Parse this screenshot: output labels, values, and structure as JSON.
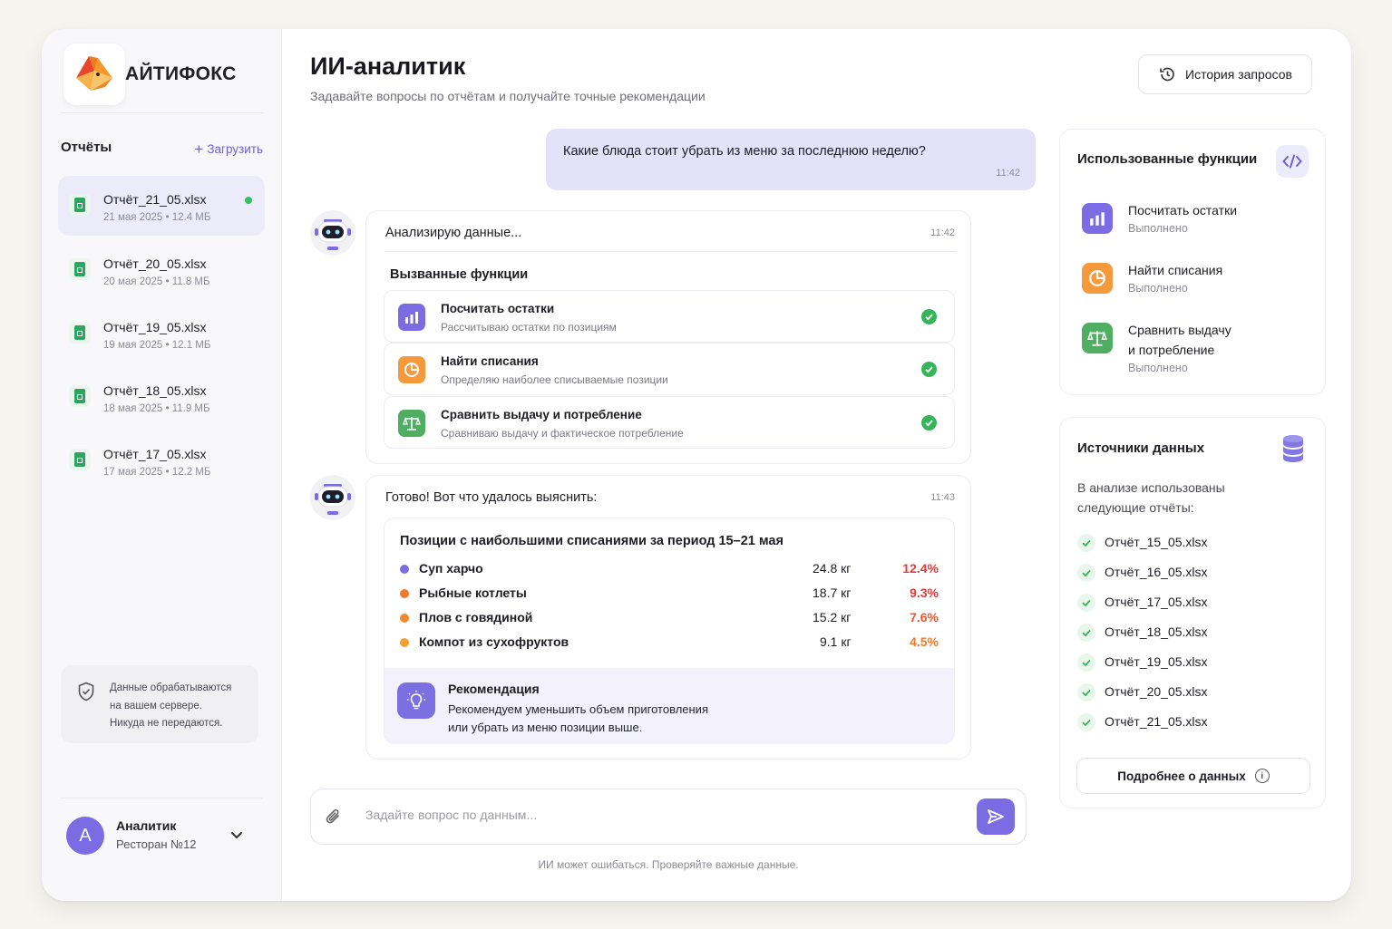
{
  "brand": {
    "name": "АЙТИФОКС"
  },
  "sidebar": {
    "reports_title": "Отчёты",
    "upload_label": "Загрузить",
    "files": [
      {
        "name": "Отчёт_21_05.xlsx",
        "meta": "21 мая 2025 • 12.4 МБ",
        "active": true
      },
      {
        "name": "Отчёт_20_05.xlsx",
        "meta": "20 мая 2025 • 11.8 МБ"
      },
      {
        "name": "Отчёт_19_05.xlsx",
        "meta": "19 мая 2025 • 12.1 МБ"
      },
      {
        "name": "Отчёт_18_05.xlsx",
        "meta": "18 мая 2025 • 11.9 МБ"
      },
      {
        "name": "Отчёт_17_05.xlsx",
        "meta": "17 мая 2025 • 12.2 МБ"
      }
    ],
    "security_lines": [
      "Данные обрабатываются",
      "на вашем сервере.",
      "Никуда не передаются."
    ],
    "user": {
      "initial": "А",
      "name": "Аналитик",
      "sub": "Ресторан №12"
    }
  },
  "header": {
    "title": "ИИ-аналитик",
    "subtitle": "Задавайте вопросы по отчётам и получайте точные рекомендации",
    "history_label": "История запросов"
  },
  "chat": {
    "user_message": {
      "text": "Какие блюда стоит убрать из меню за последнюю неделю?",
      "time": "11:42"
    },
    "analyzing": {
      "text": "Анализирую данные...",
      "time": "11:42",
      "functions_title": "Вызванные функции",
      "functions": [
        {
          "title": "Посчитать остатки",
          "desc": "Рассчитываю остатки по позициям",
          "icon": "bar-chart-icon",
          "color": "#7b6ce3"
        },
        {
          "title": "Найти списания",
          "desc": "Определяю наиболее списываемые позиции",
          "icon": "pie-chart-icon",
          "color": "#f59a3c"
        },
        {
          "title": "Сравнить выдачу и потребление",
          "desc": "Сравниваю выдачу и фактическое потребление",
          "icon": "scales-icon",
          "color": "#4fae62"
        }
      ]
    },
    "result": {
      "text": "Готово! Вот что удалось выяснить:",
      "time": "11:43",
      "table_title": "Позиции с наибольшими списаниями за период 15–21 мая",
      "rows": [
        {
          "name": "Суп харчо",
          "kg": "24.8 кг",
          "pct": "12.4%",
          "dot": "#7b6ce3",
          "pct_color": "#e03a3a"
        },
        {
          "name": "Рыбные котлеты",
          "kg": "18.7 кг",
          "pct": "9.3%",
          "dot": "#f07a2a",
          "pct_color": "#e03a3a"
        },
        {
          "name": "Плов с говядиной",
          "kg": "15.2 кг",
          "pct": "7.6%",
          "dot": "#f08a2a",
          "pct_color": "#e8552e"
        },
        {
          "name": "Компот из сухофруктов",
          "kg": "9.1 кг",
          "pct": "4.5%",
          "dot": "#f5a030",
          "pct_color": "#f07a2a"
        }
      ],
      "recommendation_title": "Рекомендация",
      "recommendation_lines": [
        "Рекомендуем уменьшить объем приготовления",
        "или убрать из меню позиции выше."
      ]
    },
    "input_placeholder": "Задайте вопрос по данным...",
    "disclaimer": "ИИ может ошибаться. Проверяйте важные данные."
  },
  "used_functions": {
    "title": "Использованные функции",
    "items": [
      {
        "title_lines": [
          "Посчитать остатки"
        ],
        "status": "Выполнено",
        "icon": "bar-chart-icon",
        "color": "#7b6ce3"
      },
      {
        "title_lines": [
          "Найти списания"
        ],
        "status": "Выполнено",
        "icon": "pie-chart-icon",
        "color": "#f59a3c"
      },
      {
        "title_lines": [
          "Сравнить выдачу",
          "и потребление"
        ],
        "status": "Выполнено",
        "icon": "scales-icon",
        "color": "#4fae62"
      }
    ]
  },
  "data_sources": {
    "title": "Источники данных",
    "text_lines": [
      "В анализе использованы",
      "следующие отчёты:"
    ],
    "files": [
      "Отчёт_15_05.xlsx",
      "Отчёт_16_05.xlsx",
      "Отчёт_17_05.xlsx",
      "Отчёт_18_05.xlsx",
      "Отчёт_19_05.xlsx",
      "Отчёт_20_05.xlsx",
      "Отчёт_21_05.xlsx"
    ],
    "more_label": "Подробнее о данных"
  }
}
